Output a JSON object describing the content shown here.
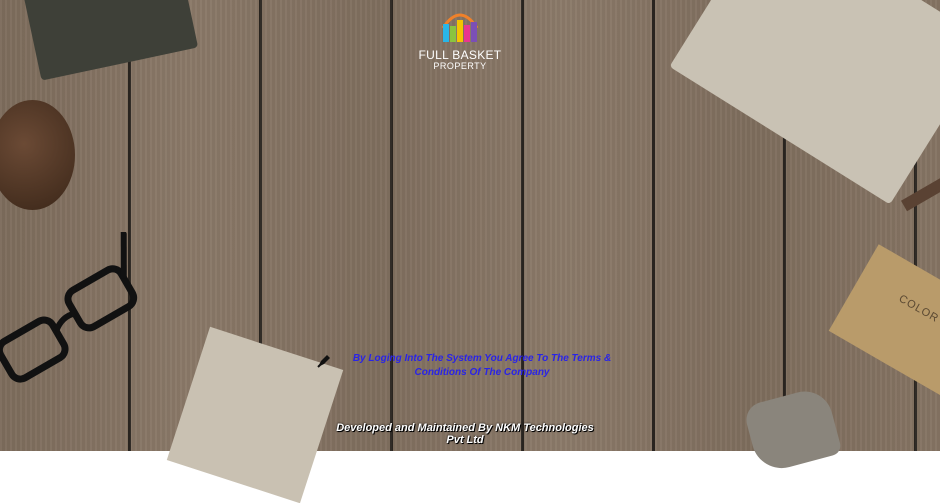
{
  "logo": {
    "title": "FULL BASKET",
    "subtitle": "PROPERTY"
  },
  "terms": {
    "text": "By Loging  Into The System You Agree To  The Terms  & Conditions  Of The Company",
    "icon": "pen-nib-icon"
  },
  "footer": {
    "text": "Developed and Maintained By NKM Technologies Pvt Ltd"
  },
  "decor": {
    "box_label": "COLOR SLIDE"
  },
  "colors": {
    "terms_link": "#2a24e6",
    "footer_text": "#ffffff",
    "overlay": "#2a2520"
  }
}
